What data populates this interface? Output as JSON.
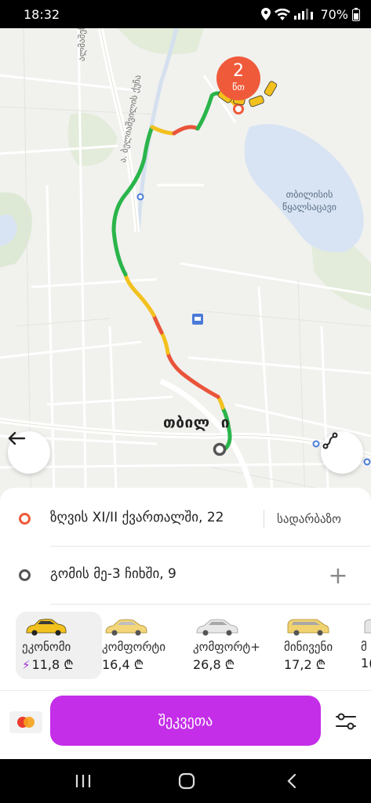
{
  "status_bar": {
    "time": "18:32",
    "battery": "70%"
  },
  "map": {
    "street_labels": [
      "ალმაშენებლის",
      "ა. ბელიაშვილის ქუჩა"
    ],
    "lake_label_line1": "თბილისის",
    "lake_label_line2": "წყალსაცავი",
    "city_label": "თბილ  ი",
    "eta_value": "2",
    "eta_unit": "წთ"
  },
  "route": {
    "pickup_address": "ზღვის XI/II ქვართალში, 22",
    "entrance_label": "სადარბაზო",
    "destination_address": "გომის მე-3 ჩიხში, 9",
    "add_stop_label": "+"
  },
  "tariffs": [
    {
      "name": "ეკონომი",
      "price": "11,8 ₾",
      "selected": true,
      "surge_icon": "lightning-icon"
    },
    {
      "name": "კომფორტი",
      "price": "16,4 ₾",
      "selected": false
    },
    {
      "name": "კომფორტ+",
      "price": "26,8 ₾",
      "selected": false
    },
    {
      "name": "მინივენი",
      "price": "17,2 ₾",
      "selected": false
    },
    {
      "name": "მ",
      "price": "1(",
      "selected": false
    }
  ],
  "action": {
    "order_label": "შეკვეთა",
    "payment_icon": "mastercard-icon",
    "options_icon": "sliders-icon"
  },
  "colors": {
    "accent": "#c42ee8",
    "pickup": "#ef5a3a",
    "route_green": "#2ab54b",
    "route_yellow": "#f2c11d",
    "route_red": "#e9543a"
  }
}
